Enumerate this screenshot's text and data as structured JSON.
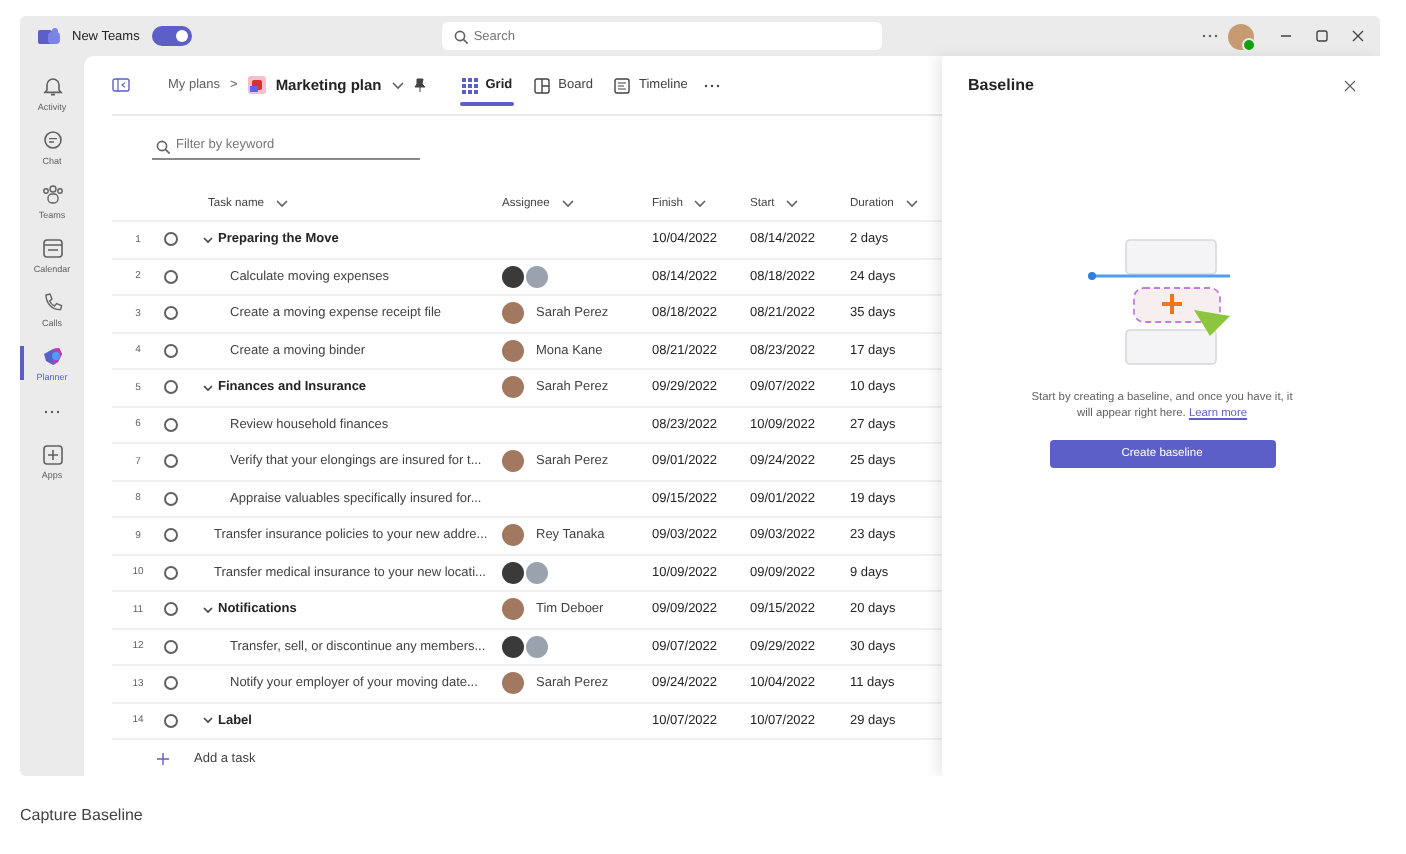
{
  "window": {
    "app_name": "New Teams",
    "new_teams_toggle": {
      "on": true
    },
    "search": {
      "placeholder": "Search"
    }
  },
  "rail": {
    "items": [
      {
        "kind": "app",
        "label": "Activity",
        "selected": false
      },
      {
        "kind": "app",
        "label": "Chat",
        "selected": false
      },
      {
        "kind": "app",
        "label": "Teams",
        "selected": false
      },
      {
        "kind": "app",
        "label": "Calendar",
        "selected": false
      },
      {
        "kind": "app",
        "label": "Calls",
        "selected": false
      },
      {
        "kind": "app",
        "label": "Planner",
        "selected": true
      },
      {
        "kind": "more"
      },
      {
        "kind": "app",
        "label": "Apps",
        "selected": false
      }
    ]
  },
  "toolbar": {
    "breadcrumb": "My plans",
    "separator": ">",
    "plan_name": "Marketing plan",
    "tabs": [
      {
        "label": "Grid",
        "selected": true
      },
      {
        "label": "Board",
        "selected": false
      },
      {
        "label": "Timeline",
        "selected": false
      }
    ]
  },
  "filter": {
    "placeholder": "Filter by keyword"
  },
  "grid": {
    "columns": [
      "Task name",
      "Assignee",
      "Finish",
      "Start",
      "Duration"
    ],
    "tasks": [
      {
        "number": "1",
        "name": "Preparing the Move",
        "checked": false,
        "expanded": true,
        "finish": "10/04/2022",
        "start": "08/14/2022",
        "duration": "2 days",
        "children": [
          {
            "number": "2",
            "name": "Calculate moving expenses",
            "checked": false,
            "assignee": {
              "kind": "pair"
            },
            "finish": "08/14/2022",
            "start": "08/18/2022",
            "duration": "24 days"
          },
          {
            "number": "3",
            "name": "Create a moving expense receipt file",
            "checked": false,
            "assignee": {
              "kind": "person",
              "name": "Sarah Perez"
            },
            "finish": "08/18/2022",
            "start": "08/21/2022",
            "duration": "35 days"
          },
          {
            "number": "4",
            "name": "Create a moving binder",
            "checked": false,
            "assignee": {
              "kind": "person",
              "name": "Mona Kane"
            },
            "finish": "08/21/2022",
            "start": "08/23/2022",
            "duration": "17 days"
          }
        ]
      },
      {
        "number": "5",
        "name": "Finances and Insurance",
        "checked": false,
        "expanded": true,
        "assignee": {
          "kind": "person",
          "name": "Sarah Perez"
        },
        "finish": "09/29/2022",
        "start": "09/07/2022",
        "duration": "10 days",
        "children": [
          {
            "number": "6",
            "name": "Review household finances",
            "checked": false,
            "finish": "08/23/2022",
            "start": "10/09/2022",
            "duration": "27 days"
          },
          {
            "number": "7",
            "name": "Verify that your elongings are insured for t...",
            "checked": false,
            "assignee": {
              "kind": "person",
              "name": "Sarah Perez"
            },
            "finish": "09/01/2022",
            "start": "09/24/2022",
            "duration": "25 days"
          },
          {
            "number": "8",
            "name": "Appraise valuables specifically insured for...",
            "checked": false,
            "finish": "09/15/2022",
            "start": "09/01/2022",
            "duration": "19 days"
          }
        ]
      },
      {
        "number": "9",
        "name": "Transfer insurance policies to your new addre...",
        "checked": false,
        "assignee": {
          "kind": "person",
          "name": "Rey Tanaka"
        },
        "finish": "09/03/2022",
        "start": "09/03/2022",
        "duration": "23 days"
      },
      {
        "number": "10",
        "name": "Transfer medical insurance to your new locati...",
        "checked": false,
        "assignee": {
          "kind": "pair"
        },
        "finish": "10/09/2022",
        "start": "09/09/2022",
        "duration": "9 days"
      },
      {
        "number": "11",
        "name": "Notifications",
        "checked": false,
        "expanded": true,
        "assignee": {
          "kind": "person",
          "name": "Tim Deboer"
        },
        "finish": "09/09/2022",
        "start": "09/15/2022",
        "duration": "20 days",
        "children": [
          {
            "number": "12",
            "name": "Transfer, sell, or discontinue any members...",
            "checked": false,
            "assignee": {
              "kind": "pair"
            },
            "finish": "09/07/2022",
            "start": "09/29/2022",
            "duration": "30 days"
          },
          {
            "number": "13",
            "name": "Notify your employer of your moving date...",
            "checked": false,
            "assignee": {
              "kind": "person",
              "name": "Sarah Perez"
            },
            "finish": "09/24/2022",
            "start": "10/04/2022",
            "duration": "11 days"
          }
        ]
      },
      {
        "number": "14",
        "name": "Label",
        "checked": false,
        "expanded": true,
        "finish": "10/07/2022",
        "start": "10/07/2022",
        "duration": "29 days"
      }
    ],
    "add_task": "Add a task"
  },
  "panel": {
    "title": "Baseline",
    "message": "Start by creating a baseline, and once you have it, it will appear right here.",
    "link": "Learn more",
    "button": "Create baseline"
  },
  "caption": "Capture Baseline"
}
